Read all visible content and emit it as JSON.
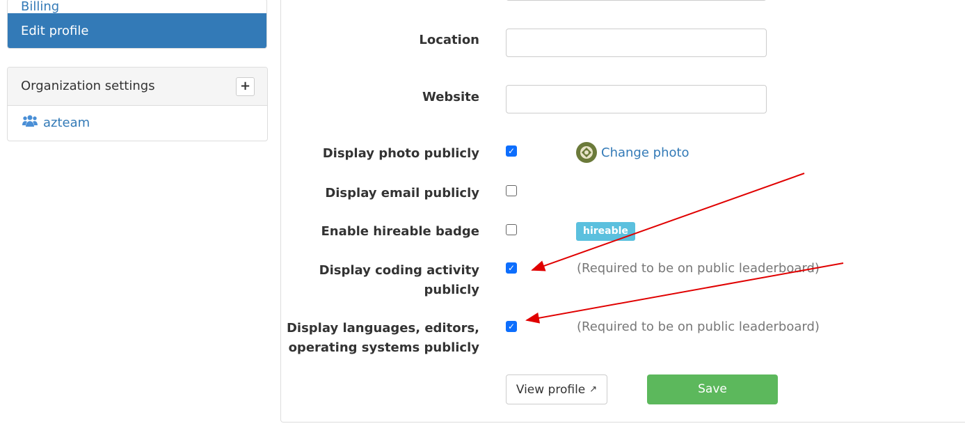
{
  "sidebar": {
    "items": [
      {
        "label": "Billing"
      },
      {
        "label": "Edit profile",
        "active": true
      }
    ],
    "org": {
      "title": "Organization settings",
      "add_button": "+",
      "items": [
        {
          "label": "azteam",
          "icon": "users-icon"
        }
      ]
    }
  },
  "form": {
    "location": {
      "label": "Location",
      "value": ""
    },
    "website": {
      "label": "Website",
      "value": ""
    },
    "display_photo": {
      "label": "Display photo publicly",
      "checked": true,
      "link": "Change photo"
    },
    "display_email": {
      "label": "Display email publicly",
      "checked": false
    },
    "hireable": {
      "label": "Enable hireable badge",
      "checked": false,
      "badge": "hireable"
    },
    "coding_activity": {
      "label1": "Display coding activity",
      "label2": "publicly",
      "checked": true,
      "hint": "(Required to be on public leaderboard)"
    },
    "languages": {
      "label1": "Display languages, editors,",
      "label2": "operating systems publicly",
      "checked": true,
      "hint": "(Required to be on public leaderboard)"
    },
    "view_profile": "View profile",
    "save": "Save"
  },
  "colors": {
    "primary": "#337ab7",
    "save": "#5cb85c",
    "badge": "#5bc0de",
    "annotation": "#e00000"
  }
}
